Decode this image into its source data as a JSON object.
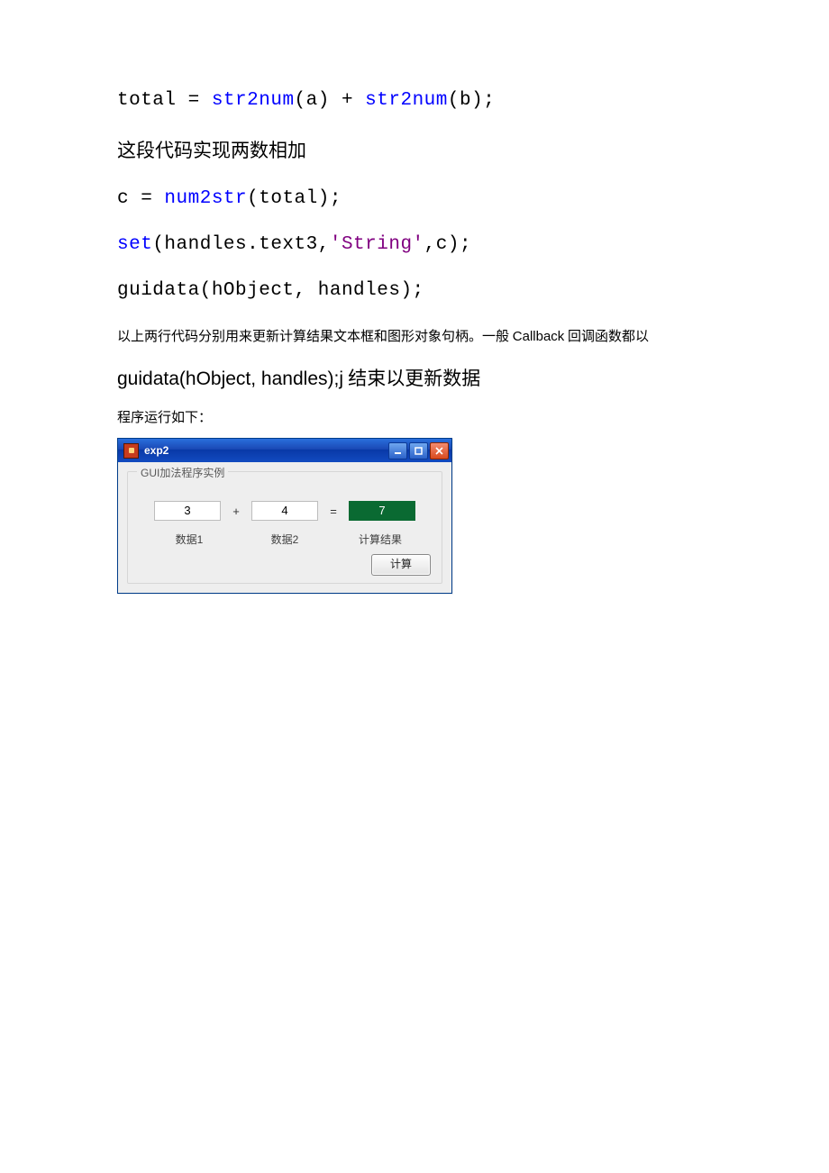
{
  "code": {
    "line1": {
      "p1": "total = ",
      "fn1": "str2num",
      "p2": "(a) + ",
      "fn2": "str2num",
      "p3": "(b);"
    },
    "note1": "这段代码实现两数相加",
    "line2": {
      "p1": "c = ",
      "fn1": "num2str",
      "p2": "(total);"
    },
    "line3": {
      "fn1": "set",
      "p1": "(handles.text3,",
      "str1": "'String'",
      "p2": ",c);"
    },
    "line4": {
      "p1": "guidata(hObject, handles);"
    }
  },
  "explain": {
    "line1_a": "以上两行代码分别用来更新计算结果文本框和图形对象句柄。一般 ",
    "line1_b": "Callback",
    "line1_c": " 回调函数都以",
    "line2_a": "guidata(hObject, handles);j",
    "line2_b": " 结束以更新数据",
    "runlabel": "程序运行如下："
  },
  "gui": {
    "title": "exp2",
    "group_label": "GUI加法程序实例",
    "input1": "3",
    "plus": "+",
    "input2": "4",
    "equals": "=",
    "result": "7",
    "label1": "数据1",
    "label2": "数据2",
    "label3": "计算结果",
    "button": "计算"
  }
}
